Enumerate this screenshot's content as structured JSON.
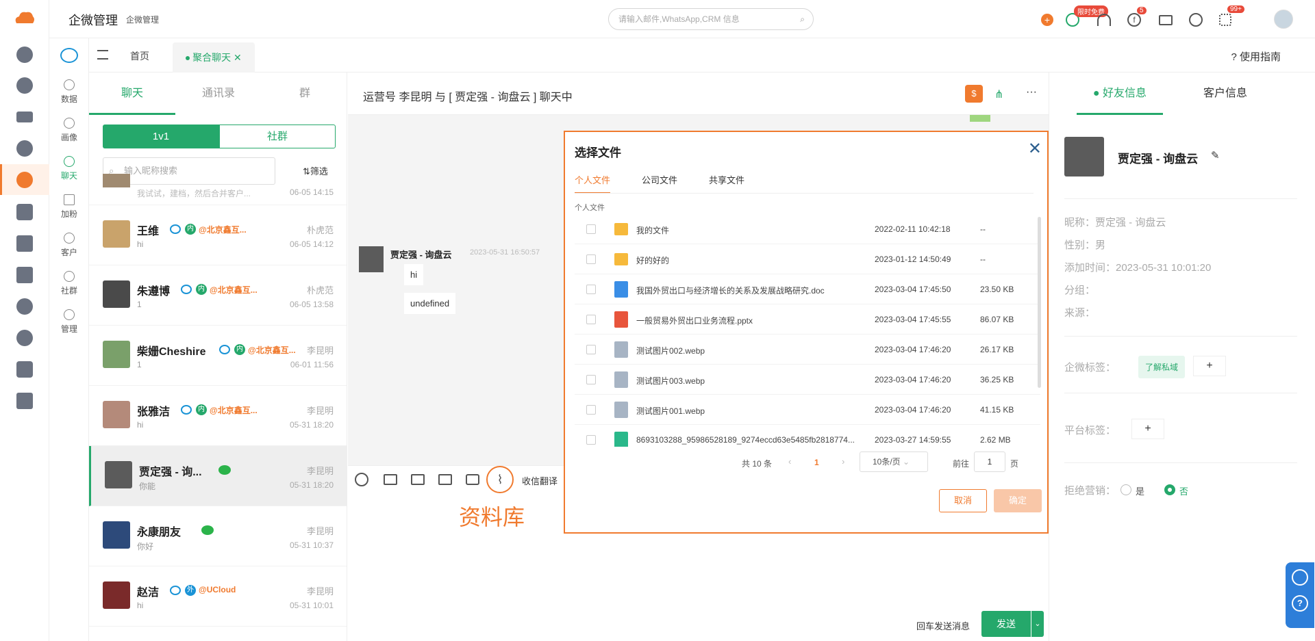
{
  "app": {
    "title": "企微管理",
    "subtitle": "企微管理",
    "search_placeholder": "请输入邮件,WhatsApp,CRM 信息",
    "badge_free": "限时免费",
    "badge_fb": "5",
    "badge_apps": "99+"
  },
  "nav2": [
    {
      "label": "数据"
    },
    {
      "label": "画像"
    },
    {
      "label": "聊天"
    },
    {
      "label": "加粉"
    },
    {
      "label": "客户"
    },
    {
      "label": "社群"
    },
    {
      "label": "管理"
    }
  ],
  "tabs": {
    "home": "首页",
    "active": "聚合聊天",
    "guide": "使用指南"
  },
  "left": {
    "tab_chat": "聊天",
    "tab_contacts": "通讯录",
    "tab_group": "群",
    "seg_1v1": "1v1",
    "seg_community": "社群",
    "search_placeholder": "输入昵称搜索",
    "filter": "筛选",
    "partial": {
      "preview": "我试试，建档，然后合并客户...",
      "time": "06-05 14:15"
    },
    "chats": [
      {
        "name": "王维",
        "tag": "@北京鑫互...",
        "type": "内",
        "owner": "朴虎范",
        "preview": "hi",
        "time": "06-05 14:12"
      },
      {
        "name": "朱遵博",
        "tag": "@北京鑫互...",
        "type": "内",
        "owner": "朴虎范",
        "preview": "1",
        "time": "06-05 13:58"
      },
      {
        "name": "柴姗Cheshire",
        "tag": "@北京鑫互...",
        "type": "内",
        "owner": "李昆明",
        "preview": "1",
        "time": "06-01 11:56"
      },
      {
        "name": "张雅洁",
        "tag": "@北京鑫互...",
        "type": "内",
        "owner": "李昆明",
        "preview": "hi",
        "time": "05-31 18:20"
      },
      {
        "name": "贾定强 - 询...",
        "tag": "",
        "type": "",
        "owner": "李昆明",
        "preview": "你能",
        "time": "05-31 18:20"
      },
      {
        "name": "永康朋友",
        "tag": "",
        "type": "",
        "owner": "李昆明",
        "preview": "你好",
        "time": "05-31 10:37"
      },
      {
        "name": "赵洁",
        "tag": "@UCloud",
        "type": "外",
        "owner": "李昆明",
        "preview": "hi",
        "time": "05-31 10:01"
      }
    ]
  },
  "mid": {
    "header": "运营号 李昆明 与 [ 贾定强 - 询盘云 ] 聊天中",
    "sender": "贾定强 - 询盘云",
    "msg_time": "2023-05-31 16:50:57",
    "msg1": "hi",
    "msg2": "undefined",
    "translate": "收信翻译",
    "library": "资料库",
    "enter_send": "回车发送消息",
    "send": "发送"
  },
  "modal": {
    "title": "选择文件",
    "tabs": [
      "个人文件",
      "公司文件",
      "共享文件"
    ],
    "section": "个人文件",
    "files": [
      {
        "name": "我的文件",
        "date": "2022-02-11 10:42:18",
        "size": "--",
        "kind": "folder"
      },
      {
        "name": "好的好的",
        "date": "2023-01-12 14:50:49",
        "size": "--",
        "kind": "folder"
      },
      {
        "name": "我国外贸出口与经济增长的关系及发展战略研究.doc",
        "date": "2023-03-04 17:45:50",
        "size": "23.50 KB",
        "kind": "doc"
      },
      {
        "name": "一般贸易外贸出口业务流程.pptx",
        "date": "2023-03-04 17:45:55",
        "size": "86.07 KB",
        "kind": "ppt"
      },
      {
        "name": "测试图片002.webp",
        "date": "2023-03-04 17:46:20",
        "size": "26.17 KB",
        "kind": "unknown"
      },
      {
        "name": "测试图片003.webp",
        "date": "2023-03-04 17:46:20",
        "size": "36.25 KB",
        "kind": "unknown"
      },
      {
        "name": "测试图片001.webp",
        "date": "2023-03-04 17:46:20",
        "size": "41.15 KB",
        "kind": "unknown"
      },
      {
        "name": "8693103288_95986528189_9274eccd63e5485fb2818774...",
        "date": "2023-03-27 14:59:55",
        "size": "2.62 MB",
        "kind": "png"
      }
    ],
    "total": "共 10 条",
    "page": "1",
    "page_size": "10条/页",
    "goto": "前往",
    "goto_value": "1",
    "page_unit": "页",
    "cancel": "取消",
    "ok": "确定"
  },
  "right": {
    "tab_friend": "好友信息",
    "tab_customer": "客户信息",
    "name": "贾定强 - 询盘云",
    "nickname": "昵称：贾定强 - 询盘云",
    "gender": "性别：男",
    "added": "添加时间：2023-05-31 10:01:20",
    "group": "分组：",
    "source": "来源：",
    "wx_tags_label": "企微标签：",
    "wx_tag": "了解私域",
    "platform_tags_label": "平台标签：",
    "reject_label": "拒绝营销：",
    "yes": "是",
    "no": "否"
  },
  "colors": {
    "accent": "#f07a2e",
    "green": "#25a86b"
  }
}
